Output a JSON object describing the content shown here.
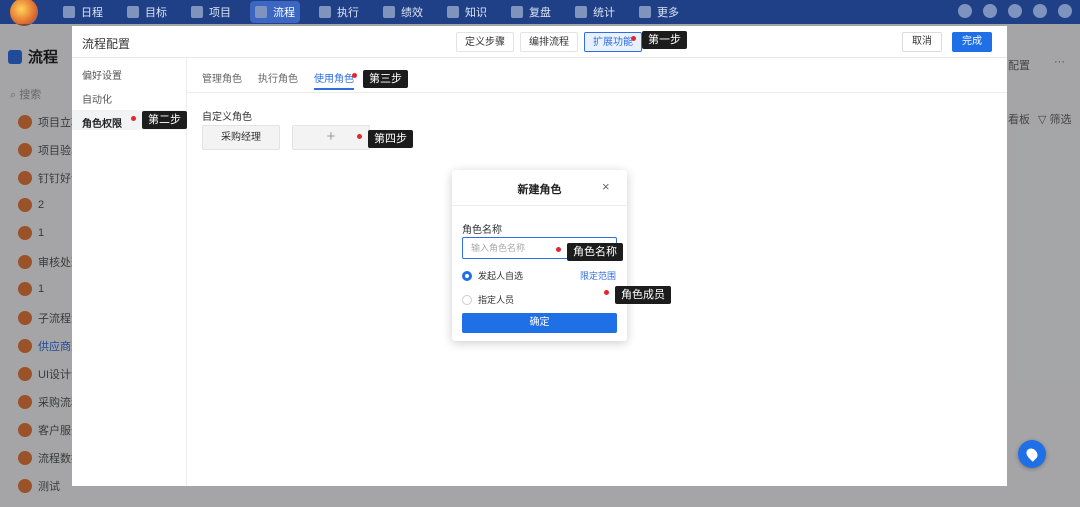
{
  "topnav": {
    "items": [
      {
        "label": "日程",
        "icon": "calendar-icon"
      },
      {
        "label": "目标",
        "icon": "target-icon"
      },
      {
        "label": "项目",
        "icon": "project-icon"
      },
      {
        "label": "流程",
        "icon": "process-icon",
        "active": true
      },
      {
        "label": "执行",
        "icon": "execute-icon"
      },
      {
        "label": "绩效",
        "icon": "performance-icon"
      },
      {
        "label": "知识",
        "icon": "knowledge-icon"
      },
      {
        "label": "复盘",
        "icon": "review-icon"
      },
      {
        "label": "统计",
        "icon": "stats-icon"
      },
      {
        "label": "更多",
        "icon": "more-icon"
      }
    ]
  },
  "background": {
    "title": "流程",
    "search": "搜索",
    "list": [
      "项目立项",
      "项目验收",
      "钉钉好评",
      "2",
      "1",
      "审核处理",
      "1",
      "子流程测",
      "供应商选",
      "UI设计流",
      "采购流程",
      "客户服务",
      "流程数据",
      "测试"
    ],
    "selected_index": 8,
    "right_config": "配置",
    "right_more": "···",
    "right_board": "看板",
    "right_filter": "筛选"
  },
  "panel": {
    "title": "流程配置",
    "step_tabs": [
      "定义步骤",
      "编排流程",
      "扩展功能"
    ],
    "cancel": "取消",
    "done": "完成",
    "side": [
      "偏好设置",
      "自动化",
      "角色权限"
    ],
    "sub_tabs": [
      "管理角色",
      "执行角色",
      "使用角色"
    ],
    "custom_role_label": "自定义角色",
    "role_card": "采购经理",
    "add_symbol": "+"
  },
  "dialog": {
    "title": "新建角色",
    "close": "×",
    "name_label": "角色名称",
    "name_placeholder": "输入角色名称",
    "name_value": "",
    "option_self": "发起人自选",
    "option_assign": "指定人员",
    "limit_link": "限定范围",
    "confirm": "确定"
  },
  "annotations": {
    "step1": "第一步",
    "step2": "第二步",
    "step3": "第三步",
    "step4": "第四步",
    "role_name": "角色名称",
    "role_member": "角色成员"
  },
  "colors": {
    "topbar": "#1f3f86",
    "primary": "#1f6fe6",
    "annotation_dot": "#e5262d"
  }
}
